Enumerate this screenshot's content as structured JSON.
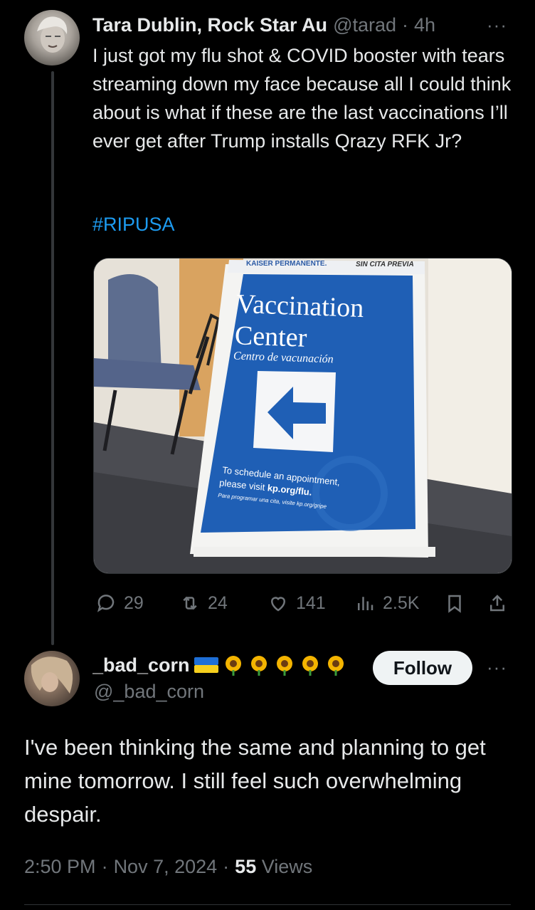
{
  "tweet": {
    "author_name": "Tara Dublin, Rock Star Au",
    "handle": "@tarad",
    "separator": "·",
    "time": "4h",
    "more": "···",
    "text": "I just got my flu shot & COVID booster with tears streaming down my face because all I could think about is what if these are the last vaccinations I’ll ever get after Trump installs Qrazy RFK Jr?",
    "hashtag": "#RIPUSA",
    "image": {
      "sign_brand": "KAISER PERMANENTE.",
      "sign_tag": "SIN CITA PREVIA",
      "sign_title_1": "Vaccination",
      "sign_title_2": "Center",
      "sign_subtitle": "Centro de vacunación",
      "sign_line_1": "To schedule an appointment,",
      "sign_line_2_prefix": "please visit ",
      "sign_line_2_link": "kp.org/flu.",
      "sign_line_3": "Para programar una cita, visite kp.org/gripe",
      "colors": {
        "sign_blue": "#1f5fb5",
        "wall": "#e8e4dc",
        "floor": "#4a4b50"
      }
    },
    "metrics": {
      "replies": "29",
      "reposts": "24",
      "likes": "141",
      "views": "2.5K"
    }
  },
  "reply": {
    "author_name": "_bad_corn",
    "handle": "@_bad_corn",
    "follow_label": "Follow",
    "more": "···",
    "text": "I've been thinking the same and planning to get mine tomorrow. I still feel such overwhelming despair.",
    "time": "2:50 PM",
    "separator": "·",
    "date": "Nov 7, 2024",
    "views_count": "55",
    "views_label": "Views"
  },
  "colors": {
    "background": "#000000",
    "accent": "#1d9bf0",
    "muted": "#71767b",
    "text": "#e7e9ea"
  }
}
